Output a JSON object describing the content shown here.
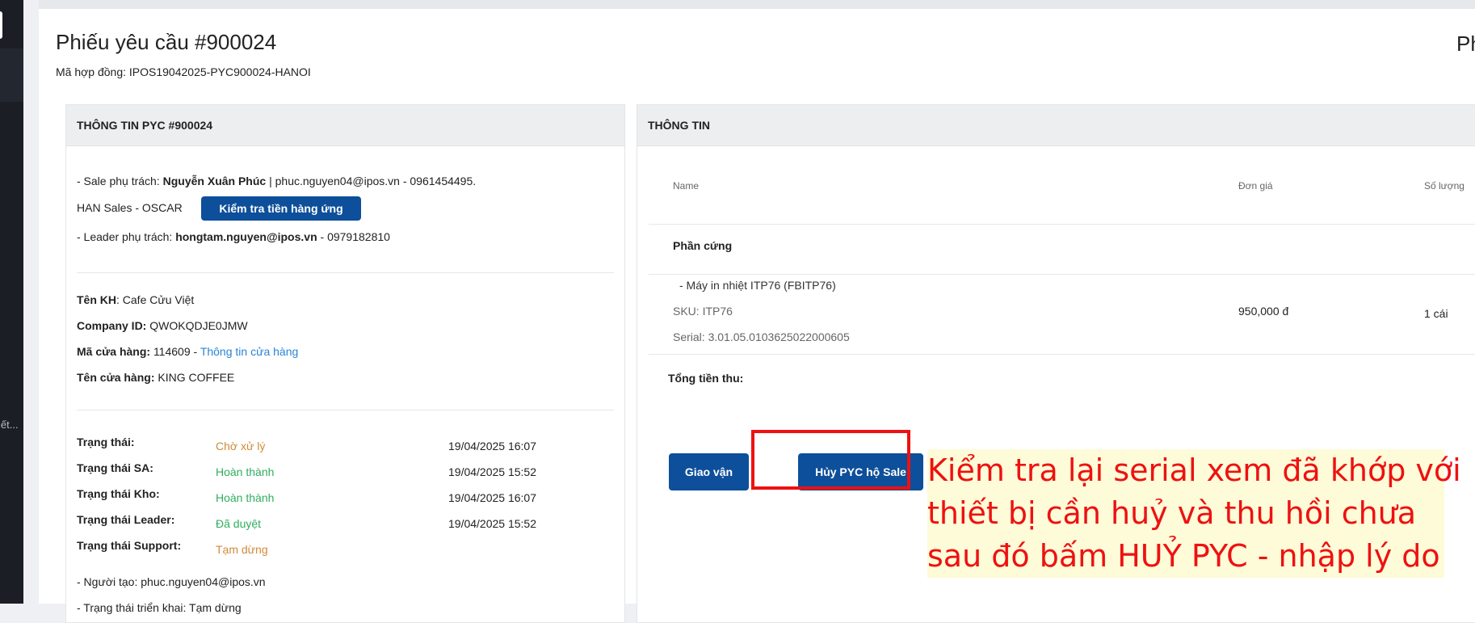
{
  "page": {
    "title": "Phiếu yêu cầu #900024",
    "title_right_cut": "Ph",
    "contract_label": "Mã hợp đồng:",
    "contract_code": "IPOS19042025-PYC900024-HANOI"
  },
  "sidebar": {
    "cut_text": "iết..."
  },
  "left_card": {
    "header": "THÔNG TIN PYC #900024",
    "sale_prefix": "- Sale phụ trách:",
    "sale_name": "Nguyễn Xuân Phúc",
    "sale_contact": "| phuc.nguyen04@ipos.vn - 0961454495.",
    "team": "HAN Sales - OSCAR",
    "check_button": "Kiểm tra tiền hàng ứng",
    "leader_prefix": "- Leader phụ trách:",
    "leader_email": "hongtam.nguyen@ipos.vn",
    "leader_phone": "- 0979182810",
    "customer_label": "Tên KH",
    "customer_value": ": Cafe Cửu Việt",
    "company_label": "Company ID:",
    "company_value": "QWOKQDJE0JMW",
    "store_code_label": "Mã cửa hàng:",
    "store_code_value": "114609 -",
    "store_info_link": "Thông tin cửa hàng",
    "store_name_label": "Tên cửa hàng:",
    "store_name_value": "KING COFFEE",
    "statuses": [
      {
        "label": "Trạng thái:",
        "value": "Chờ xử lý",
        "color": "#d08a3a",
        "time": "19/04/2025 16:07"
      },
      {
        "label": "Trạng thái SA:",
        "value": "Hoàn thành",
        "color": "#2fae5e",
        "time": "19/04/2025 15:52"
      },
      {
        "label": "Trạng thái Kho:",
        "value": "Hoàn thành",
        "color": "#2fae5e",
        "time": "19/04/2025 16:07"
      },
      {
        "label": "Trạng thái Leader:",
        "value": "Đã duyệt",
        "color": "#2fae5e",
        "time": "19/04/2025 15:52"
      },
      {
        "label": "Trạng thái Support:",
        "value": "Tạm dừng",
        "color": "#d08a3a",
        "time": ""
      }
    ],
    "creator": "- Người tạo: phuc.nguyen04@ipos.vn",
    "deploy_status": "- Trạng thái triển khai: Tạm dừng"
  },
  "right_card": {
    "header": "THÔNG TIN",
    "col_name": "Name",
    "col_price": "Đơn giá",
    "col_qty": "Số lượng",
    "group": "Phần cứng",
    "item_name": "- Máy in nhiệt ITP76 (FBITP76)",
    "item_sku": "SKU: ITP76",
    "item_serial": "Serial: 3.01.05.0103625022000605",
    "item_price": "950,000 đ",
    "item_qty": "1 cái",
    "total_label": "Tổng tiền thu:",
    "btn_shipping": "Giao vận",
    "btn_cancel": "Hủy PYC hộ Sale"
  },
  "annotation": {
    "line1": "Kiểm tra lại serial xem đã khớp với",
    "line2": "thiết bị cần huỷ và thu hồi chưa",
    "line3": "sau đó bấm HUỶ PYC - nhập lý do",
    "color": "#ee1111",
    "background": "#fdfbd8"
  }
}
